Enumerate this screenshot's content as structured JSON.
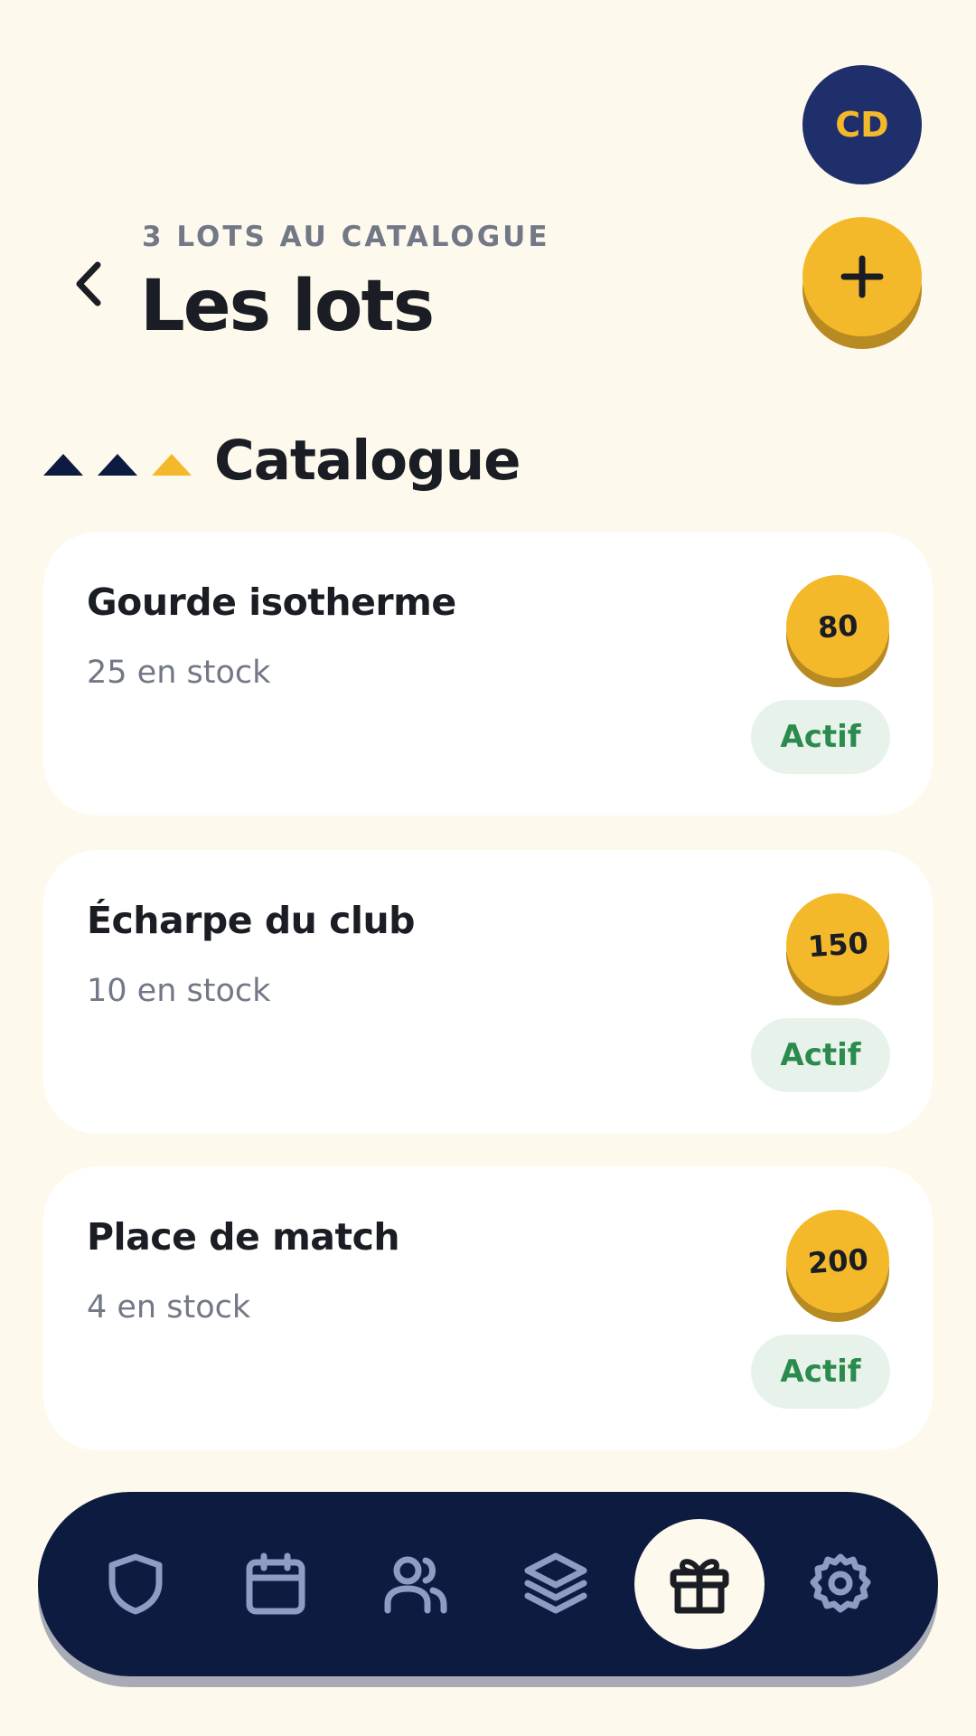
{
  "header": {
    "avatar_initials": "CD",
    "subtitle": "3 LOTS AU CATALOGUE",
    "title": "Les lots"
  },
  "section": {
    "title": "Catalogue"
  },
  "prizes": [
    {
      "name": "Gourde isotherme",
      "stock": "25 en stock",
      "points": "80",
      "status": "Actif"
    },
    {
      "name": "Écharpe du club",
      "stock": "10 en stock",
      "points": "150",
      "status": "Actif"
    },
    {
      "name": "Place de match",
      "stock": "4 en stock",
      "points": "200",
      "status": "Actif"
    }
  ],
  "nav": {
    "items": [
      "shield-icon",
      "calendar-icon",
      "users-icon",
      "layers-icon",
      "gift-icon",
      "gear-icon"
    ],
    "active": "gift-icon"
  },
  "colors": {
    "background": "#fdf9ec",
    "navy": "#0e1b41",
    "accent": "#f4b92a",
    "status_green": "#2b8a4e"
  }
}
